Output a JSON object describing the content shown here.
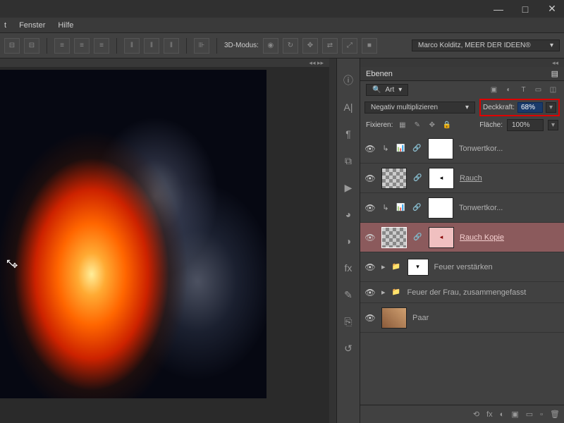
{
  "menu": {
    "item1": "t",
    "item2": "Fenster",
    "item3": "Hilfe"
  },
  "optionbar": {
    "mode_label": "3D-Modus:",
    "workspace": "Marco Kolditz, MEER DER IDEEN®"
  },
  "panel": {
    "title": "Ebenen",
    "kind_label": "Art",
    "blend_mode": "Negativ multiplizieren",
    "opacity_label": "Deckkraft:",
    "opacity_value": "68%",
    "lock_label": "Fixieren:",
    "fill_label": "Fläche:",
    "fill_value": "100%"
  },
  "layers": [
    {
      "name": "Tonwertkor...",
      "type": "adj"
    },
    {
      "name": "Rauch",
      "type": "img",
      "underline": true
    },
    {
      "name": "Tonwertkor...",
      "type": "adj"
    },
    {
      "name": "Rauch Kopie",
      "type": "img",
      "underline": true,
      "selected": true
    },
    {
      "name": "Feuer verstärken",
      "type": "group"
    },
    {
      "name": "Feuer der Frau, zusammengefasst",
      "type": "group-collapsed"
    },
    {
      "name": "Paar",
      "type": "plain"
    }
  ],
  "footer_icons": [
    "⟲",
    "fx",
    "◐",
    "▣",
    "▭",
    "▫",
    "🗑"
  ]
}
